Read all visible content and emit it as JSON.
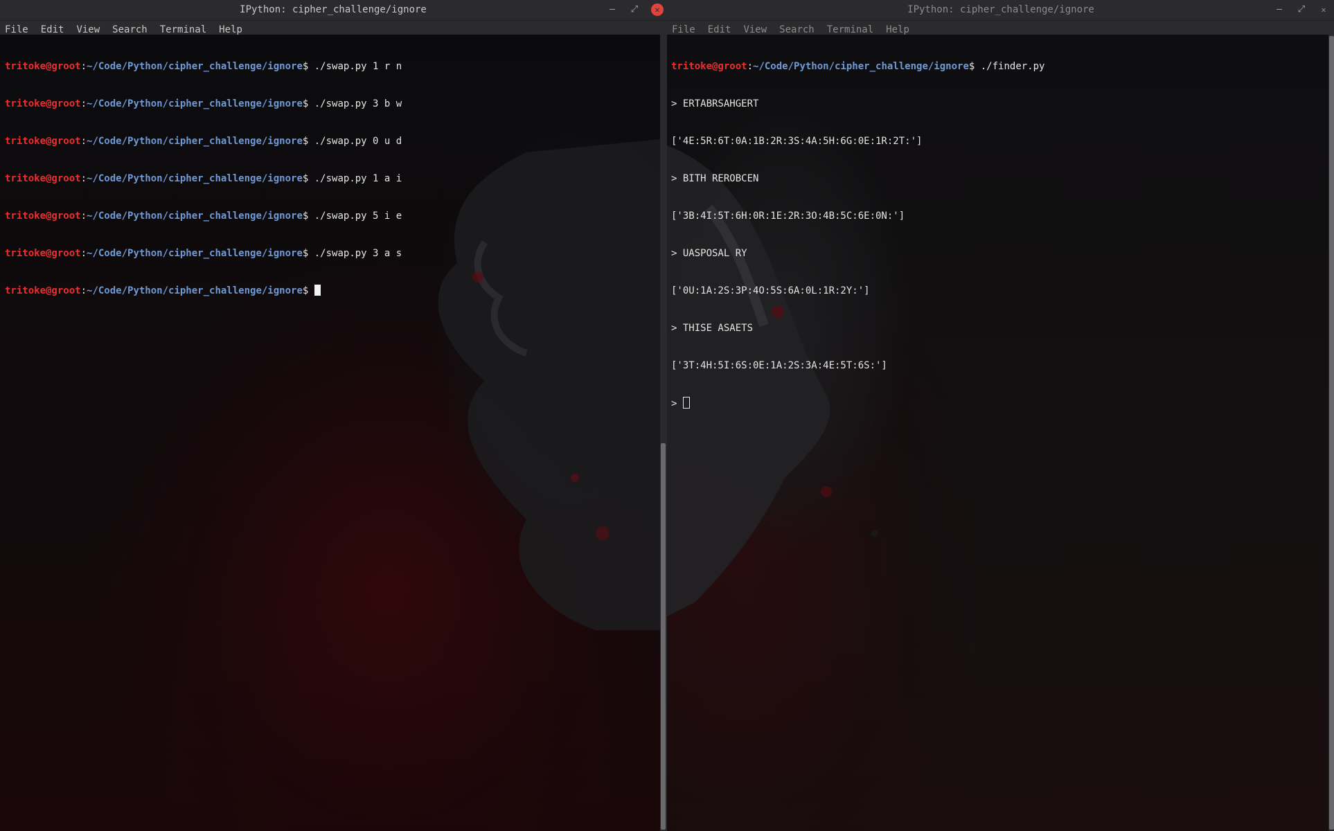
{
  "left": {
    "title": "IPython: cipher_challenge/ignore",
    "menu": [
      "File",
      "Edit",
      "View",
      "Search",
      "Terminal",
      "Help"
    ],
    "lines": [
      {
        "user": "tritoke@groot",
        "sep": ":",
        "path": "~/Code/Python/cipher_challenge/ignore",
        "prompt": "$ ",
        "cmd": "./swap.py 1 r n"
      },
      {
        "user": "tritoke@groot",
        "sep": ":",
        "path": "~/Code/Python/cipher_challenge/ignore",
        "prompt": "$ ",
        "cmd": "./swap.py 3 b w"
      },
      {
        "user": "tritoke@groot",
        "sep": ":",
        "path": "~/Code/Python/cipher_challenge/ignore",
        "prompt": "$ ",
        "cmd": "./swap.py 0 u d"
      },
      {
        "user": "tritoke@groot",
        "sep": ":",
        "path": "~/Code/Python/cipher_challenge/ignore",
        "prompt": "$ ",
        "cmd": "./swap.py 1 a i"
      },
      {
        "user": "tritoke@groot",
        "sep": ":",
        "path": "~/Code/Python/cipher_challenge/ignore",
        "prompt": "$ ",
        "cmd": "./swap.py 5 i e"
      },
      {
        "user": "tritoke@groot",
        "sep": ":",
        "path": "~/Code/Python/cipher_challenge/ignore",
        "prompt": "$ ",
        "cmd": "./swap.py 3 a s"
      }
    ],
    "current": {
      "user": "tritoke@groot",
      "sep": ":",
      "path": "~/Code/Python/cipher_challenge/ignore",
      "prompt": "$ "
    }
  },
  "right": {
    "title": "IPython: cipher_challenge/ignore",
    "menu": [
      "File",
      "Edit",
      "View",
      "Search",
      "Terminal",
      "Help"
    ],
    "first": {
      "user": "tritoke@groot",
      "sep": ":",
      "path": "~/Code/Python/cipher_challenge/ignore",
      "prompt": "$ ",
      "cmd": "./finder.py"
    },
    "output": [
      "> ERTABRSAHGERT",
      "['4E:5R:6T:0A:1B:2R:3S:4A:5H:6G:0E:1R:2T:']",
      "> BITH REROBCEN",
      "['3B:4I:5T:6H:0R:1E:2R:3O:4B:5C:6E:0N:']",
      "> UASPOSAL RY",
      "['0U:1A:2S:3P:4O:5S:6A:0L:1R:2Y:']",
      "> THISE ASAETS",
      "['3T:4H:5I:6S:0E:1A:2S:3A:4E:5T:6S:']"
    ],
    "input_prompt": "> "
  },
  "colors": {
    "user": "#ef2d2d",
    "path": "#6f9ad6",
    "text": "#e6e6e6",
    "close": "#e0443c"
  }
}
